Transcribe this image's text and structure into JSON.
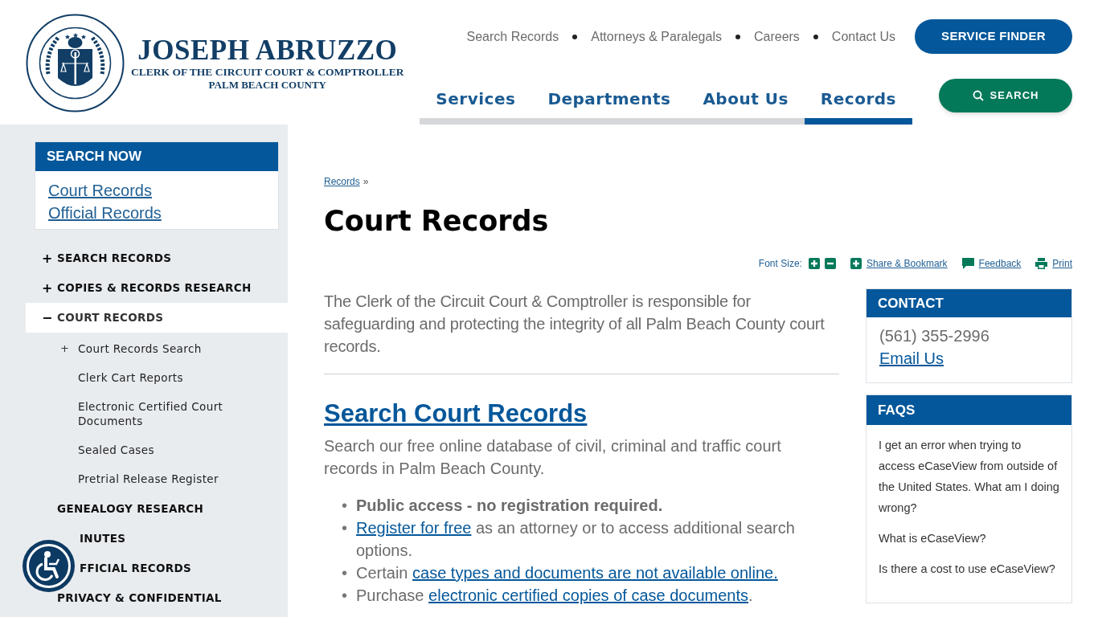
{
  "logo": {
    "name": "JOSEPH ABRUZZO",
    "line1": "CLERK OF THE CIRCUIT COURT & COMPTROLLER",
    "line2": "PALM BEACH COUNTY"
  },
  "utility_links": [
    "Search Records",
    "Attorneys & Paralegals",
    "Careers",
    "Contact Us"
  ],
  "service_finder_button": "SERVICE FINDER",
  "main_nav": [
    {
      "label": "Services",
      "selected": false
    },
    {
      "label": "Departments",
      "selected": false
    },
    {
      "label": "About Us",
      "selected": false
    },
    {
      "label": "Records",
      "selected": true
    }
  ],
  "search_button": "SEARCH",
  "sidebar": {
    "search_now": {
      "title": "SEARCH NOW",
      "links": [
        "Court Records",
        "Official Records"
      ]
    },
    "items": [
      {
        "toggle": "+",
        "label": "SEARCH RECORDS",
        "selected": false
      },
      {
        "toggle": "+",
        "label": "COPIES & RECORDS RESEARCH",
        "selected": false
      },
      {
        "toggle": "−",
        "label": "COURT RECORDS",
        "selected": true,
        "children": [
          {
            "toggle": "+",
            "label": "Court Records Search",
            "selected": false
          },
          {
            "label": "Clerk Cart Reports",
            "selected": false
          },
          {
            "label": "Electronic Certified Court Documents",
            "selected": false
          },
          {
            "label": "Sealed Cases",
            "selected": false
          },
          {
            "label": "Pretrial Release Register",
            "selected": false
          }
        ]
      },
      {
        "label": "GENEALOGY RESEARCH",
        "selected": false
      },
      {
        "label": "INUTES",
        "selected": false
      },
      {
        "label": "FFICIAL RECORDS",
        "selected": false
      },
      {
        "label": "PRIVACY & CONFIDENTIAL",
        "selected": false
      }
    ]
  },
  "breadcrumb": {
    "link": "Records",
    "separator": "»"
  },
  "page_title": "Court Records",
  "tools": {
    "font_size_label": "Font Size:",
    "links": [
      "Share & Bookmark",
      "Feedback",
      "Print"
    ]
  },
  "intro": "The Clerk of the Circuit Court & Comptroller is responsible for safeguarding and protecting the integrity of all Palm Beach County court records.",
  "section": {
    "heading": "Search Court Records",
    "text": "Search our free online database of civil, criminal and traffic court records in Palm Beach County.",
    "bullets": [
      {
        "kind": "bold",
        "marker": "•",
        "parts": [
          {
            "text": "Public access - no registration required.",
            "link": false
          }
        ]
      },
      {
        "kind": "plain",
        "marker": "•",
        "parts": [
          {
            "text": "Register for free",
            "link": true
          },
          {
            "text": " as an attorney or to access additional search options.",
            "link": false
          }
        ]
      },
      {
        "kind": "plain",
        "marker": "•",
        "parts": [
          {
            "text": "Certain ",
            "link": false
          },
          {
            "text": "case types and documents are not available online.",
            "link": true
          }
        ]
      },
      {
        "kind": "plain",
        "marker": "•",
        "parts": [
          {
            "text": "Purchase ",
            "link": false
          },
          {
            "text": "electronic certified copies of case documents",
            "link": true
          },
          {
            "text": ".",
            "link": false
          }
        ]
      }
    ]
  },
  "contact": {
    "title": "CONTACT",
    "phone": "(561) 355-2996",
    "email_link": "Email Us"
  },
  "faqs": {
    "title": "FAQS",
    "items": [
      "I get an error when trying to access eCaseView from outside of the United States. What am I doing wrong?",
      "What is eCaseView?",
      "Is there a cost to use eCaseView?"
    ]
  }
}
